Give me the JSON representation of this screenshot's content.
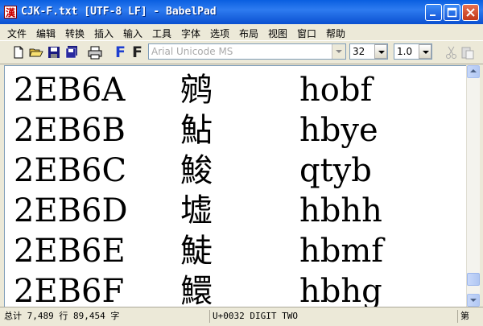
{
  "window": {
    "icon_glyph": "漢",
    "title": "CJK-F.txt [UTF-8 LF] - BabelPad"
  },
  "menu": [
    "文件",
    "编辑",
    "转换",
    "插入",
    "输入",
    "工具",
    "字体",
    "选项",
    "布局",
    "视图",
    "窗口",
    "帮助"
  ],
  "toolbar": {
    "font_name": "Arial Unicode MS",
    "font_size": "32",
    "line_spacing": "1.0",
    "font_button_blue": "F",
    "font_button_black": "F"
  },
  "rows": [
    {
      "code": "2EB6A",
      "char": "鹓",
      "key": "hobf"
    },
    {
      "code": "2EB6B",
      "char": "鮎",
      "key": "hbye"
    },
    {
      "code": "2EB6C",
      "char": "鮻",
      "key": "qtyb"
    },
    {
      "code": "2EB6D",
      "char": "墟",
      "key": "hbhh"
    },
    {
      "code": "2EB6E",
      "char": "鯐",
      "key": "hbmf"
    },
    {
      "code": "2EB6F",
      "char": "鱞",
      "key": "hbhg"
    }
  ],
  "status": {
    "counts": "总计 7,489 行 89,454 字",
    "char_info": "U+0032 DIGIT TWO",
    "right": "第"
  },
  "colors": {
    "title_bar": "#0A5FE0",
    "close_button": "#C23818",
    "font_blue": "#1E3FD0"
  }
}
